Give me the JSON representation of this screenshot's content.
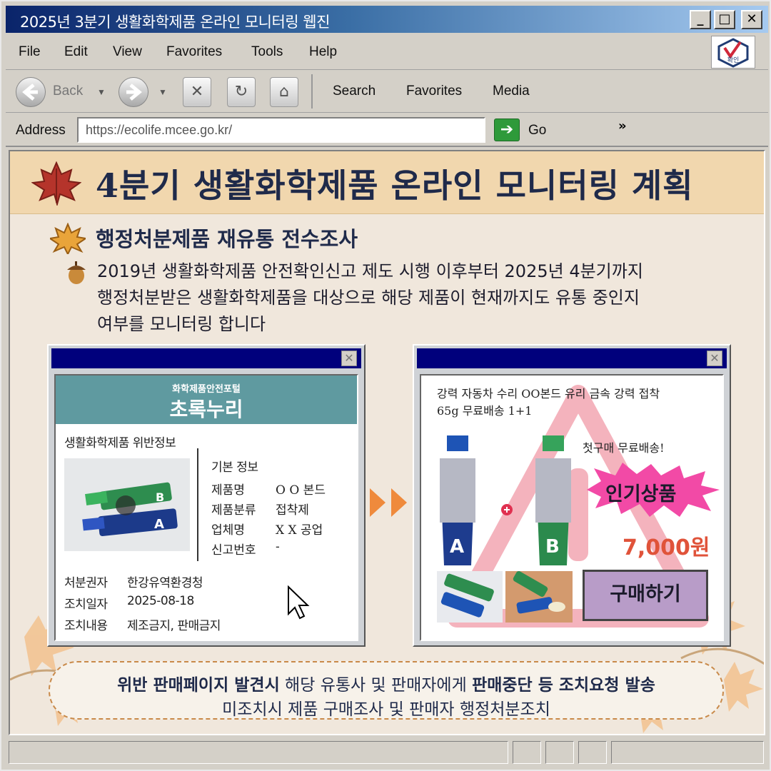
{
  "window": {
    "title": "2025년 3분기 생활화학제품 온라인 모니터링 웹진",
    "minimize": "_",
    "maximize": "□",
    "close": "✕"
  },
  "menu": [
    "File",
    "Edit",
    "View",
    "Favorites",
    "Tools",
    "Help"
  ],
  "logo_text": "확인",
  "toolbar": {
    "back": "Back",
    "search": "Search",
    "favorites": "Favorites",
    "media": "Media"
  },
  "address": {
    "label": "Address",
    "url": "https://ecolife.mcee.go.kr/",
    "go": "Go",
    "more": "»"
  },
  "page": {
    "banner_title": "4분기 생활화학제품 온라인 모니터링 계획",
    "section_title": "행정처분제품 재유통 전수조사",
    "body": [
      "2019년 생활화학제품 안전확인신고 제도 시행 이후부터 2025년 4분기까지",
      "행정처분받은 생활화학제품을 대상으로 해당 제품이 현재까지도 유통 중인지",
      "여부를 모니터링 합니다"
    ]
  },
  "popup_left": {
    "close": "✕",
    "portal_small": "화학제품안전포털",
    "portal_big": "초록누리",
    "heading": "생활화학제품 위반정보",
    "basic_info": "기본 정보",
    "fields": [
      {
        "label": "제품명",
        "value": "O O 본드"
      },
      {
        "label": "제품분류",
        "value": "접착제"
      },
      {
        "label": "업체명",
        "value": "X X 공업"
      },
      {
        "label": "신고번호",
        "value": "-"
      }
    ],
    "actions": [
      {
        "label": "처분권자",
        "value": "한강유역환경청"
      },
      {
        "label": "조치일자",
        "value": "2025-08-18"
      },
      {
        "label": "조치내용",
        "value": "제조금지, 판매금지"
      }
    ],
    "tube_a": "A",
    "tube_b": "B"
  },
  "popup_right": {
    "close": "✕",
    "product_title_1": "강력 자동차 수리 OO본드 유리 금속 강력 접착",
    "product_title_2": "65g 무료배송 1+1",
    "promo": "첫구매 무료배송!",
    "badge": "인기상품",
    "price": "7,000원",
    "buy": "구매하기",
    "tube_a": "A",
    "tube_b": "B"
  },
  "footer": {
    "l1_bold1": "위반 판매페이지 발견시",
    "l1_mid": " 해당 유통사 및 판매자에게 ",
    "l1_bold2": "판매중단 등 조치요청 발송",
    "l2": "미조치시 제품 구매조사 및 판매자 행정처분조치"
  },
  "colors": {
    "titlebar": "#0a246a",
    "banner": "#f1d7ae",
    "portal": "#5f9aa0",
    "price": "#e0533a",
    "badge": "#f04aa0",
    "buy": "#b89cc8"
  }
}
